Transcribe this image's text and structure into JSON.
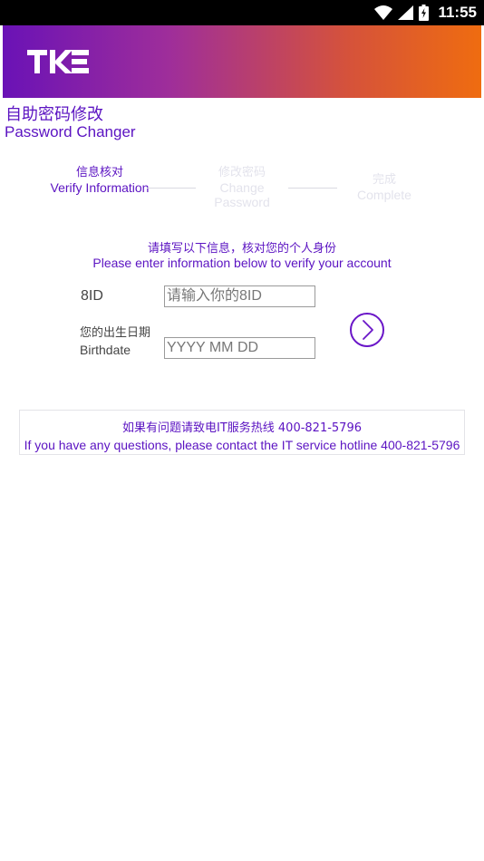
{
  "status_bar": {
    "time": "11:55",
    "icons": [
      "wifi-icon",
      "signal-icon",
      "battery-icon"
    ]
  },
  "header": {
    "logo_text": "TKE",
    "title_cn": "自助密码修改",
    "title_en": "Password Changer"
  },
  "steps": [
    {
      "cn": "信息核对",
      "en": "Verify Information",
      "state": "active"
    },
    {
      "cn": "修改密码",
      "en": "Change Password",
      "state": "inactive"
    },
    {
      "cn": "完成",
      "en": "Complete",
      "state": "inactive"
    }
  ],
  "form": {
    "prompt_cn": "请填写以下信息，核对您的个人身份",
    "prompt_en": "Please enter information below to verify your account",
    "id_label": "8ID",
    "id_placeholder": "请输入你的8ID",
    "birth_label_cn": "您的出生日期",
    "birth_label_en": "Birthdate",
    "birth_placeholder": "YYYY MM DD",
    "next_icon": "chevron-right-circle-icon"
  },
  "help": {
    "cn": "如果有问题请致电IT服务热线 400-821-5796",
    "en": "If you have any questions, please contact the IT service hotline 400-821-5796"
  },
  "colors": {
    "accent": "#5b13c2",
    "banner_start": "#6a12b6",
    "banner_end": "#ef6c10"
  }
}
